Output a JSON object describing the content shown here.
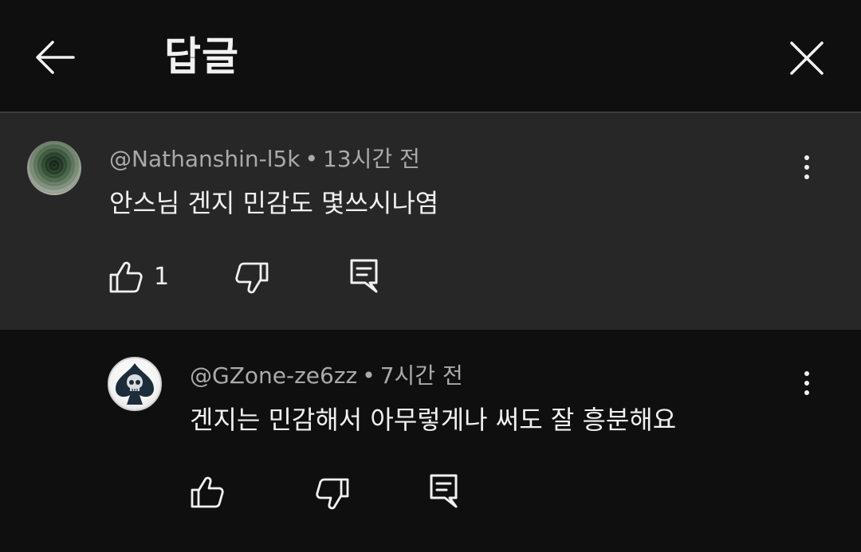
{
  "header": {
    "title": "답글"
  },
  "parent_comment": {
    "author": "@Nathanshin-l5k",
    "separator": "•",
    "time": "13시간 전",
    "text": "안스님 겐지 민감도 몇쓰시나염",
    "like_count": "1"
  },
  "reply_comment": {
    "author": "@GZone-ze6zz",
    "separator": "•",
    "time": "7시간 전",
    "text": "겐지는 민감해서 아무렇게나 써도 잘 흥분해요"
  },
  "icons": {
    "back": "arrow-left-icon",
    "close": "close-icon",
    "more": "more-vertical-icon",
    "like": "thumb-up-icon",
    "dislike": "thumb-down-icon",
    "reply": "comment-icon"
  },
  "colors": {
    "background": "#0f0f0f",
    "highlight": "#272727",
    "text_primary": "#f1f1f1",
    "text_secondary": "#aaaaaa"
  }
}
